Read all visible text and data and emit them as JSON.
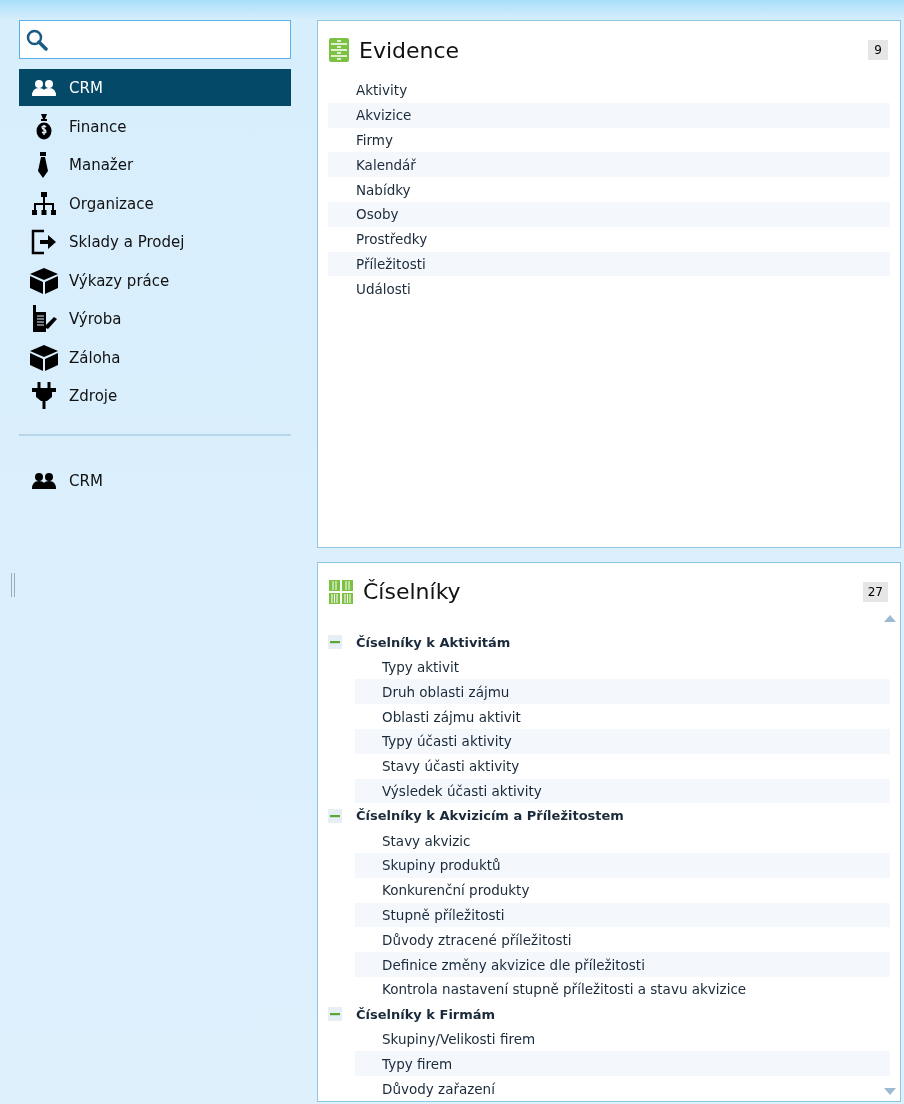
{
  "nav": [
    {
      "label": "CRM",
      "selected": true
    },
    {
      "label": "Finance",
      "selected": false
    },
    {
      "label": "Manažer",
      "selected": false
    },
    {
      "label": "Organizace",
      "selected": false
    },
    {
      "label": "Sklady a Prodej",
      "selected": false
    },
    {
      "label": "Výkazy práce",
      "selected": false
    },
    {
      "label": "Výroba",
      "selected": false
    },
    {
      "label": "Záloha",
      "selected": false
    },
    {
      "label": "Zdroje",
      "selected": false
    }
  ],
  "recent": [
    {
      "label": "CRM"
    }
  ],
  "evidence": {
    "title": "Evidence",
    "count": "9",
    "items": [
      "Aktivity",
      "Akvizice",
      "Firmy",
      "Kalendář",
      "Nabídky",
      "Osoby",
      "Prostředky",
      "Příležitosti",
      "Události"
    ]
  },
  "ciselniky": {
    "title": "Číselníky",
    "count": "27",
    "groups": [
      {
        "label": "Číselníky k Aktivitám",
        "expanded": true,
        "children": [
          "Typy aktivit",
          "Druh oblasti zájmu",
          "Oblasti zájmu aktivit",
          "Typy účasti aktivity",
          "Stavy účasti aktivity",
          "Výsledek účasti aktivity"
        ]
      },
      {
        "label": "Číselníky k Akvizicím a Příležitostem",
        "expanded": true,
        "children": [
          "Stavy akvizic",
          "Skupiny produktů",
          "Konkurenční produkty",
          "Stupně příležitosti",
          "Důvody ztracené příležitosti",
          "Definice změny akvizice dle příležitosti",
          "Kontrola nastavení stupně příležitosti a stavu akvizice"
        ]
      },
      {
        "label": "Číselníky k Firmám",
        "expanded": true,
        "children": [
          "Skupiny/Velikosti firem",
          "Typy firem",
          "Důvody zařazení"
        ]
      }
    ]
  }
}
